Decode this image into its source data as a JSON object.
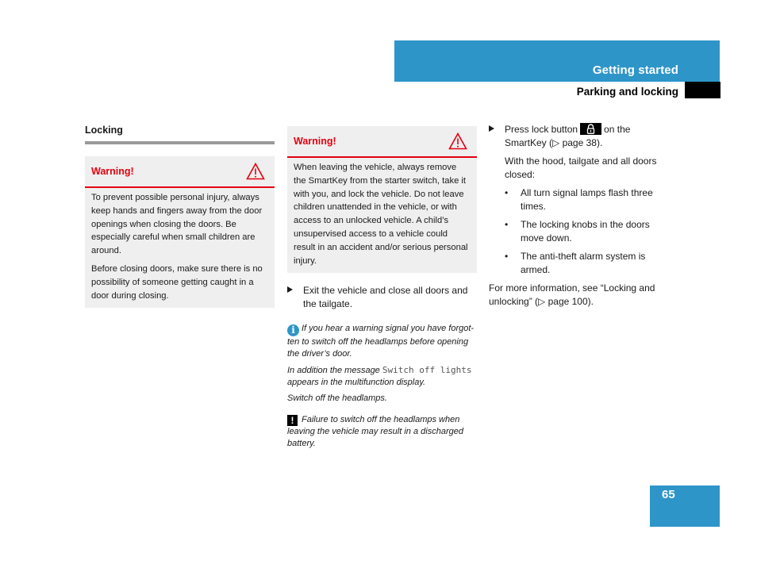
{
  "header": {
    "section_title": "Getting started",
    "subsection_title": "Parking and locking",
    "accent_color": "#2e95c9"
  },
  "page_number": "65",
  "column1": {
    "heading": "Locking",
    "warning": {
      "title": "Warning!",
      "icon": "warning-triangle-icon",
      "paragraphs": [
        "To prevent possible personal injury, always keep hands and fingers away from the door openings when closing the doors. Be especially careful when small children are around.",
        "Before closing doors, make sure there is no possibility of someone getting caught in a door during closing."
      ]
    }
  },
  "column2": {
    "warning": {
      "title": "Warning!",
      "icon": "warning-triangle-icon",
      "paragraphs": [
        "When leaving the vehicle, always remove the SmartKey from the starter switch, take it with you, and lock the vehicle. Do not leave children unattended in the vehicle, or with access to an unlocked vehicle. A child’s unsupervised access to a vehicle could result in an accident and/or serious personal injury."
      ]
    },
    "step": "Exit the vehicle and close all doors and the tailgate.",
    "info_note": {
      "icon": "info-icon",
      "text": "If you hear a warning signal you have forgot-ten to switch off the headlamps before opening the driver’s door.",
      "message_prefix": "In addition the message ",
      "display_message": "Switch off lights",
      "message_suffix": " appears in the multifunction display.",
      "action": "Switch off the headlamps."
    },
    "caution_note": {
      "icon": "exclamation-icon",
      "text": "Failure to switch off the headlamps when leaving the vehicle may result in a discharged battery."
    }
  },
  "column3": {
    "step_prefix": "Press lock button",
    "step_suffix": "on the SmartKey (▷ page 38).",
    "condition": "With the hood, tailgate and all doors closed:",
    "bullets": [
      "All turn signal lamps flash three times.",
      "The locking knobs in the doors move down.",
      "The anti-theft alarm system is armed."
    ],
    "more_info": "For more information, see “Locking and unlocking” (▷ page 100)."
  }
}
